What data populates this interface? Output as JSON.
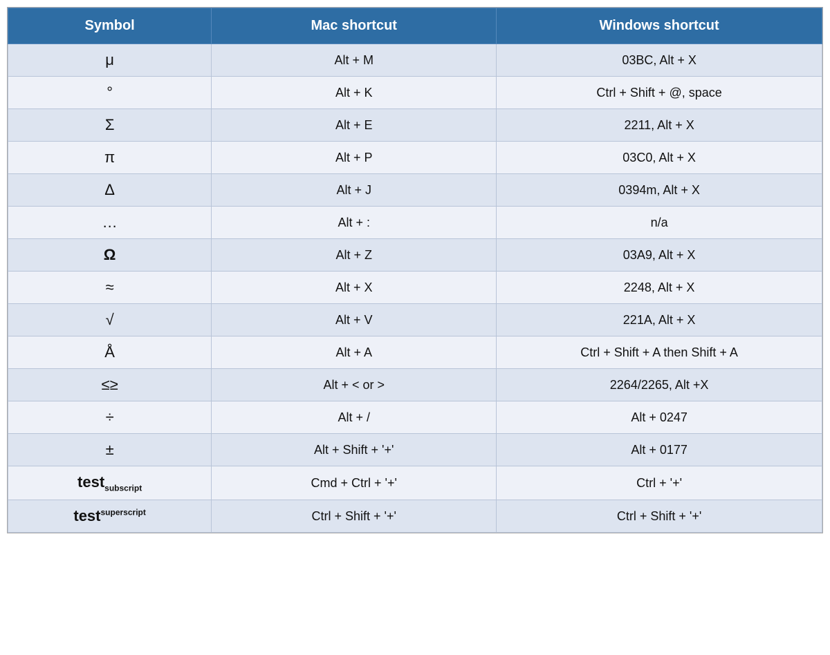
{
  "table": {
    "headers": {
      "symbol": "Symbol",
      "mac": "Mac shortcut",
      "windows": "Windows shortcut"
    },
    "rows": [
      {
        "symbol": "μ",
        "symbolBold": false,
        "symbolSub": null,
        "symbolSup": null,
        "mac": "Alt + M",
        "windows": "03BC, Alt + X"
      },
      {
        "symbol": "°",
        "symbolBold": false,
        "symbolSub": null,
        "symbolSup": null,
        "mac": "Alt + K",
        "windows": "Ctrl + Shift + @, space"
      },
      {
        "symbol": "Σ",
        "symbolBold": false,
        "symbolSub": null,
        "symbolSup": null,
        "mac": "Alt + E",
        "windows": "2211, Alt + X"
      },
      {
        "symbol": "π",
        "symbolBold": false,
        "symbolSub": null,
        "symbolSup": null,
        "mac": "Alt + P",
        "windows": "03C0, Alt + X"
      },
      {
        "symbol": "Δ",
        "symbolBold": false,
        "symbolSub": null,
        "symbolSup": null,
        "mac": "Alt + J",
        "windows": "0394m, Alt + X"
      },
      {
        "symbol": "…",
        "symbolBold": false,
        "symbolSub": null,
        "symbolSup": null,
        "mac": "Alt + :",
        "windows": "n/a"
      },
      {
        "symbol": "Ω",
        "symbolBold": true,
        "symbolSub": null,
        "symbolSup": null,
        "mac": "Alt + Z",
        "windows": "03A9, Alt + X"
      },
      {
        "symbol": "≈",
        "symbolBold": false,
        "symbolSub": null,
        "symbolSup": null,
        "mac": "Alt + X",
        "windows": "2248, Alt + X"
      },
      {
        "symbol": "√",
        "symbolBold": false,
        "symbolSub": null,
        "symbolSup": null,
        "mac": "Alt + V",
        "windows": "221A, Alt + X"
      },
      {
        "symbol": "Å",
        "symbolBold": false,
        "symbolSub": null,
        "symbolSup": null,
        "mac": "Alt + A",
        "windows": "Ctrl + Shift + A then Shift + A"
      },
      {
        "symbol": "≤≥",
        "symbolBold": false,
        "symbolSub": null,
        "symbolSup": null,
        "mac": "Alt + < or >",
        "windows": "2264/2265, Alt +X"
      },
      {
        "symbol": "÷",
        "symbolBold": false,
        "symbolSub": null,
        "symbolSup": null,
        "mac": "Alt + /",
        "windows": "Alt + 0247"
      },
      {
        "symbol": "±",
        "symbolBold": false,
        "symbolSub": null,
        "symbolSup": null,
        "mac": "Alt + Shift + '+'",
        "windows": "Alt + 0177"
      },
      {
        "symbol": "test",
        "symbolBold": true,
        "symbolSub": "subscript",
        "symbolSup": null,
        "mac": "Cmd + Ctrl + '+'",
        "windows": "Ctrl + '+'"
      },
      {
        "symbol": "test",
        "symbolBold": true,
        "symbolSub": null,
        "symbolSup": "superscript",
        "mac": "Ctrl + Shift + '+'",
        "windows": "Ctrl + Shift + '+'"
      }
    ]
  }
}
